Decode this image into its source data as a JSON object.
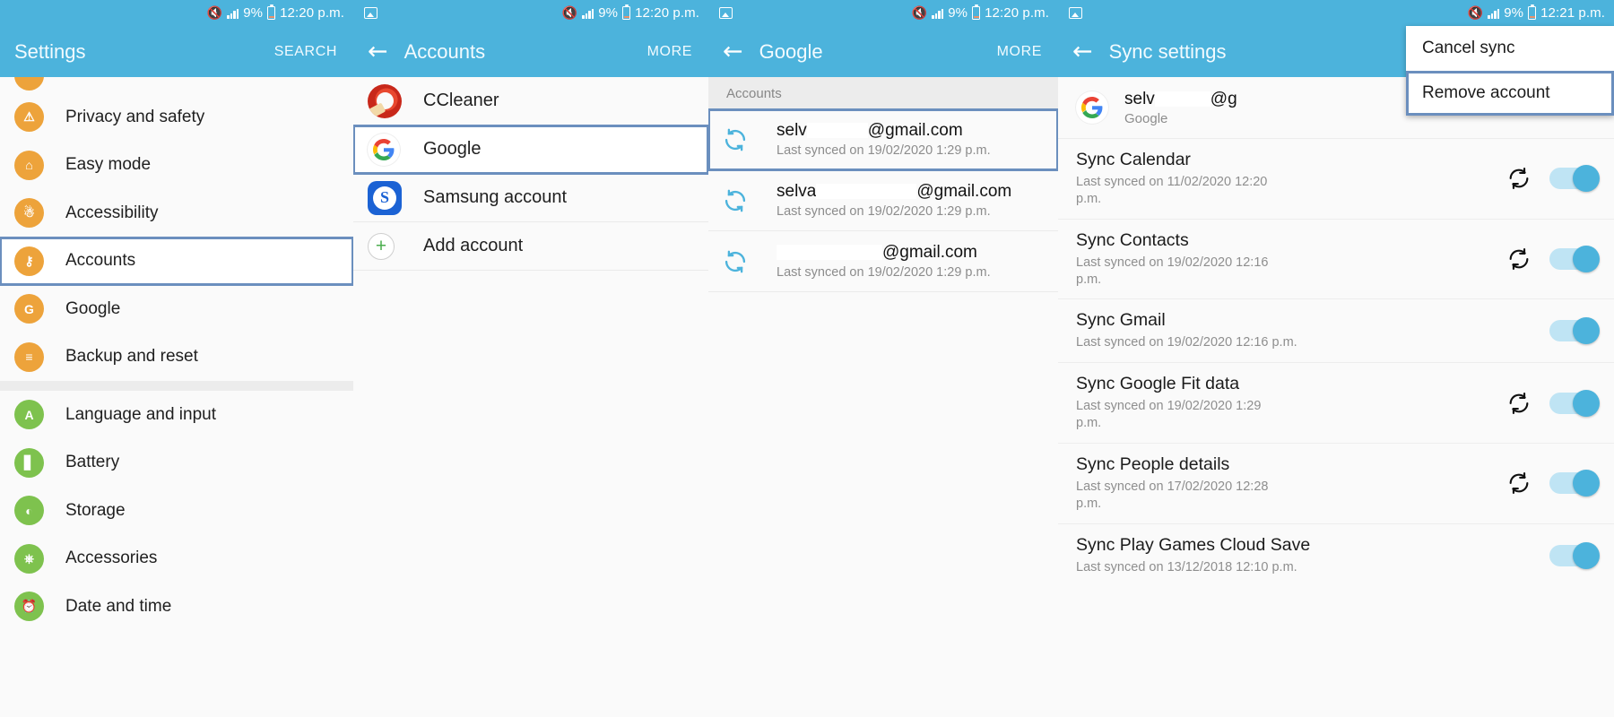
{
  "colors": {
    "accent": "#4cb3dc",
    "highlight_box": "#6b8fbe",
    "icon_orange": "#eda33b",
    "icon_green": "#7ec24e",
    "toggle_on": "#4cb3dc"
  },
  "panels": [
    {
      "id": "settings",
      "statusbar": {
        "mute_icon": "mute-icon",
        "signal_icon": "signal-icon",
        "battery_text": "9%",
        "battery_icon": "battery-icon",
        "time": "12:20 p.m."
      },
      "appbar": {
        "title": "Settings",
        "action": "SEARCH",
        "back": ""
      },
      "items": [
        {
          "label": "Privacy and safety",
          "icon": "privacy-icon",
          "color": "orange",
          "glyph": "!",
          "highlighted": false
        },
        {
          "label": "Easy mode",
          "icon": "home-icon",
          "color": "orange",
          "glyph": "⌂",
          "highlighted": false
        },
        {
          "label": "Accessibility",
          "icon": "accessibility-icon",
          "color": "orange",
          "glyph": "Ɣ",
          "highlighted": false
        },
        {
          "label": "Accounts",
          "icon": "key-icon",
          "color": "orange",
          "glyph": "⚷",
          "highlighted": true
        },
        {
          "label": "Google",
          "icon": "google-icon",
          "color": "orange",
          "glyph": "G",
          "highlighted": false
        },
        {
          "label": "Backup and reset",
          "icon": "backup-icon",
          "color": "orange",
          "glyph": "≡",
          "highlighted": false
        },
        {
          "label": "Language and input",
          "icon": "language-icon",
          "color": "green",
          "glyph": "A",
          "highlighted": false
        },
        {
          "label": "Battery",
          "icon": "battery-icon",
          "color": "green",
          "glyph": "❙",
          "highlighted": false
        },
        {
          "label": "Storage",
          "icon": "storage-icon",
          "color": "green",
          "glyph": "◔",
          "highlighted": false
        },
        {
          "label": "Accessories",
          "icon": "accessories-icon",
          "color": "green",
          "glyph": "⎙",
          "highlighted": false
        },
        {
          "label": "Date and time",
          "icon": "calendar-clock-icon",
          "color": "green",
          "glyph": "⚯",
          "highlighted": false
        }
      ]
    },
    {
      "id": "accounts",
      "statusbar": {
        "gallery_icon": "gallery-icon",
        "mute_icon": "mute-icon",
        "signal_icon": "signal-icon",
        "battery_text": "9%",
        "battery_icon": "battery-icon",
        "time": "12:20 p.m."
      },
      "appbar": {
        "title": "Accounts",
        "action": "MORE",
        "back": "←"
      },
      "items": [
        {
          "label": "CCleaner",
          "icon": "ccleaner-icon",
          "highlighted": false
        },
        {
          "label": "Google",
          "icon": "google-icon",
          "highlighted": true
        },
        {
          "label": "Samsung account",
          "icon": "samsung-icon",
          "highlighted": false
        },
        {
          "label": "Add account",
          "icon": "plus-icon",
          "highlighted": false
        }
      ]
    },
    {
      "id": "google",
      "statusbar": {
        "gallery_icon": "gallery-icon",
        "mute_icon": "mute-icon",
        "signal_icon": "signal-icon",
        "battery_text": "9%",
        "battery_icon": "battery-icon",
        "time": "12:20 p.m."
      },
      "appbar": {
        "title": "Google",
        "action": "MORE",
        "back": "←"
      },
      "section_header": "Accounts",
      "accounts": [
        {
          "prefix": "selv",
          "redact_width": 68,
          "suffix": "@gmail.com",
          "sub": "Last synced on 19/02/2020  1:29 p.m.",
          "highlighted": true
        },
        {
          "prefix": "selva",
          "redact_width": 112,
          "suffix": "@gmail.com",
          "sub": "Last synced on 19/02/2020  1:29 p.m.",
          "highlighted": false
        },
        {
          "prefix": "",
          "redact_width": 118,
          "suffix": "@gmail.com",
          "sub": "Last synced on 19/02/2020  1:29 p.m.",
          "highlighted": false
        }
      ]
    },
    {
      "id": "sync_settings",
      "statusbar": {
        "gallery_icon": "gallery-icon",
        "mute_icon": "mute-icon",
        "signal_icon": "signal-icon",
        "battery_text": "9%",
        "battery_icon": "battery-icon",
        "time": "12:21 p.m."
      },
      "appbar": {
        "title": "Sync settings",
        "action": "",
        "back": "←"
      },
      "popup_menu": {
        "items": [
          {
            "label": "Cancel sync",
            "selected": false
          },
          {
            "label": "Remove account",
            "selected": true
          }
        ]
      },
      "account_header": {
        "prefix": "selv",
        "redact_width": 62,
        "suffix": "@g",
        "sub": "Google",
        "icon": "google-icon"
      },
      "sync_items": [
        {
          "name": "Sync Calendar",
          "sub": "Last synced on 11/02/2020  12:20 p.m.",
          "refreshing": true,
          "toggle": "on"
        },
        {
          "name": "Sync Contacts",
          "sub": "Last synced on 19/02/2020  12:16 p.m.",
          "refreshing": true,
          "toggle": "on"
        },
        {
          "name": "Sync Gmail",
          "sub": "Last synced on 19/02/2020  12:16 p.m.",
          "refreshing": false,
          "toggle": "on"
        },
        {
          "name": "Sync Google Fit data",
          "sub": "Last synced on 19/02/2020  1:29 p.m.",
          "refreshing": true,
          "toggle": "on"
        },
        {
          "name": "Sync People details",
          "sub": "Last synced on 17/02/2020  12:28 p.m.",
          "refreshing": true,
          "toggle": "on"
        },
        {
          "name": "Sync Play Games Cloud Save",
          "sub": "Last synced on 13/12/2018  12:10 p.m.",
          "refreshing": false,
          "toggle": "on"
        }
      ]
    }
  ]
}
